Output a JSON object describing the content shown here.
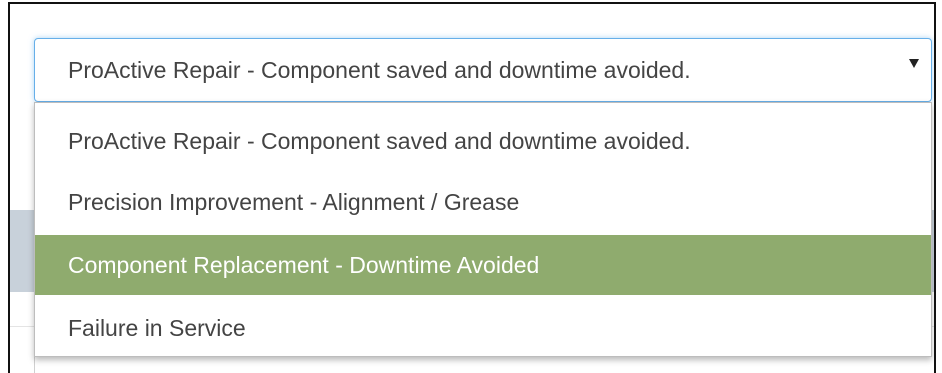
{
  "select": {
    "value": "ProActive Repair - Component saved and downtime avoided.",
    "arrow_icon": "triangle-down-icon"
  },
  "dropdown": {
    "options": [
      {
        "label": "ProActive Repair - Component saved and downtime avoided.",
        "highlighted": false
      },
      {
        "label": "Precision Improvement - Alignment / Grease",
        "highlighted": false
      },
      {
        "label": "Component Replacement - Downtime Avoided",
        "highlighted": true
      },
      {
        "label": "Failure in Service",
        "highlighted": false
      }
    ],
    "highlight_color": "#8fab6e"
  },
  "colors": {
    "focus_border": "#66afe9",
    "background_strip": "#c8d1da",
    "text": "#444444"
  }
}
